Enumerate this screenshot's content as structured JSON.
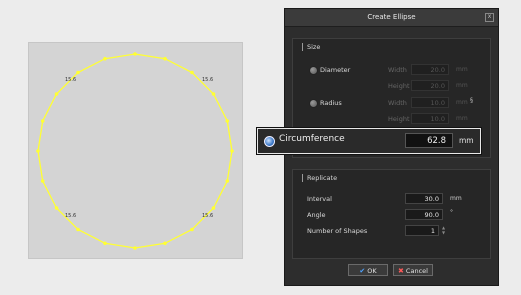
{
  "canvas": {
    "dimension_labels": [
      "15.6",
      "15.6",
      "15.6",
      "15.6"
    ],
    "stroke_color": "#ffff33",
    "background": "#d4d4d4"
  },
  "dialog": {
    "title": "Create Ellipse",
    "close_glyph": "x",
    "size": {
      "title": "Size",
      "diameter_label": "Diameter",
      "radius_label": "Radius",
      "width_label": "Width",
      "height_label": "Height",
      "diameter_width": "20.0",
      "diameter_height": "20.0",
      "radius_width": "10.0",
      "radius_height": "10.0",
      "unit": "mm"
    },
    "circumference": {
      "label": "Circumference",
      "value": "62.8",
      "unit": "mm"
    },
    "replicate": {
      "title": "Replicate",
      "interval_label": "Interval",
      "interval_value": "30.0",
      "interval_unit": "mm",
      "angle_label": "Angle",
      "angle_value": "90.0",
      "angle_unit": "°",
      "shapes_label": "Number of Shapes",
      "shapes_value": "1"
    },
    "ok_label": "OK",
    "cancel_label": "Cancel",
    "accent": "#3c79c8"
  }
}
